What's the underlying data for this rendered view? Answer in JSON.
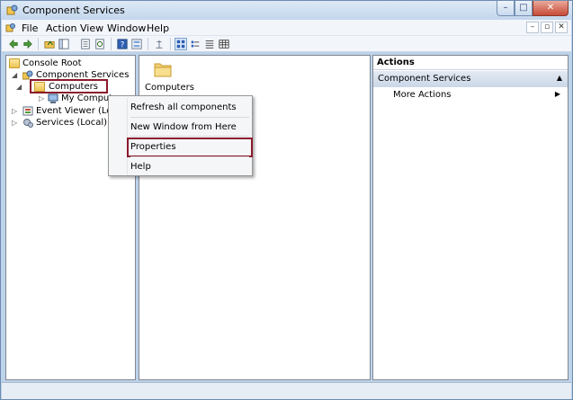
{
  "window": {
    "title": "Component Services",
    "caption_min": "–",
    "caption_max": "□",
    "caption_close": "✕"
  },
  "menu": {
    "items": [
      "File",
      "Action",
      "View",
      "Window",
      "Help"
    ],
    "mdi_min": "–",
    "mdi_restore": "▫",
    "mdi_close": "✕"
  },
  "toolbar": {
    "icons": [
      "back-icon",
      "forward-icon",
      "up-folder-icon",
      "show-hide-tree-icon",
      "export-list-icon",
      "refresh-icon",
      "help-icon",
      "properties-icon",
      "spin-icon",
      "large-icons-icon",
      "small-icons-icon",
      "list-view-icon",
      "details-view-icon"
    ]
  },
  "tree": {
    "console_root": "Console Root",
    "component_services": "Component Services",
    "computers": "Computers",
    "my_computer": "My Computer",
    "event_viewer": "Event Viewer (Local)",
    "services": "Services (Local)"
  },
  "list": {
    "items": [
      {
        "label": "Computers",
        "icon": "folder-icon"
      }
    ]
  },
  "actions": {
    "header": "Actions",
    "group": "Component Services",
    "more_actions": "More Actions"
  },
  "context_menu": {
    "refresh": "Refresh all components",
    "new_window": "New Window from Here",
    "properties": "Properties",
    "help": "Help"
  },
  "colors": {
    "highlight_border": "#8b1a2c",
    "frame": "#bcd3ea",
    "actions_group_bg": "#cbd8e8"
  }
}
